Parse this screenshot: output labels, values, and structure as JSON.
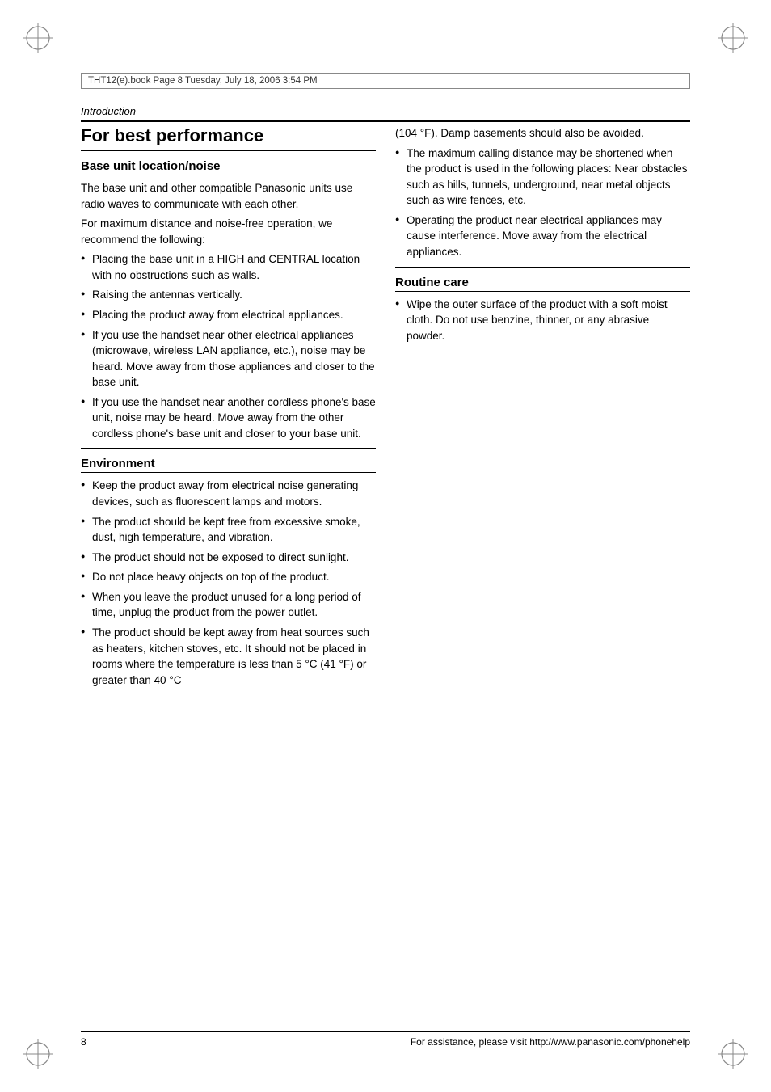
{
  "page": {
    "file_info": "THT12(e).book  Page 8  Tuesday, July 18, 2006  3:54 PM",
    "section_label": "Introduction",
    "page_title": "For best performance",
    "footer_page_num": "8",
    "footer_url": "For assistance, please visit http://www.panasonic.com/phonehelp"
  },
  "left_col": {
    "base_unit_heading": "Base unit location/noise",
    "base_unit_intro1": "The base unit and other compatible Panasonic units use radio waves to communicate with each other.",
    "base_unit_intro2": "For maximum distance and noise-free operation, we recommend the following:",
    "base_unit_bullets": [
      "Placing the base unit in a HIGH and CENTRAL location with no obstructions such as walls.",
      "Raising the antennas vertically.",
      "Placing the product away from electrical appliances.",
      "If you use the handset near other electrical appliances (microwave, wireless LAN appliance, etc.), noise may be heard. Move away from those appliances and closer to the base unit.",
      "If you use the handset near another cordless phone's base unit, noise may be heard. Move away from the other cordless phone's base unit and closer to your base unit."
    ],
    "environment_heading": "Environment",
    "environment_bullets": [
      "Keep the product away from electrical noise generating devices, such as fluorescent lamps and motors.",
      "The product should be kept free from excessive smoke, dust, high temperature, and vibration.",
      "The product should not be exposed to direct sunlight.",
      "Do not place heavy objects on top of the product.",
      "When you leave the product unused for a long period of time, unplug the product from the power outlet.",
      "The product should be kept away from heat sources such as heaters, kitchen stoves, etc. It should not be placed in rooms where the temperature is less than 5 °C (41 °F) or greater than 40 °C"
    ]
  },
  "right_col": {
    "continued_text1": "(104 °F). Damp basements should also be avoided.",
    "right_bullets_1": [
      "The maximum calling distance may be shortened when the product is used in the following places: Near obstacles such as hills, tunnels, underground, near metal objects such as wire fences, etc.",
      "Operating the product near electrical appliances may cause interference. Move away from the electrical appliances."
    ],
    "routine_care_heading": "Routine care",
    "routine_care_bullets": [
      "Wipe the outer surface of the product with a soft moist cloth. Do not use benzine, thinner, or any abrasive powder."
    ]
  }
}
